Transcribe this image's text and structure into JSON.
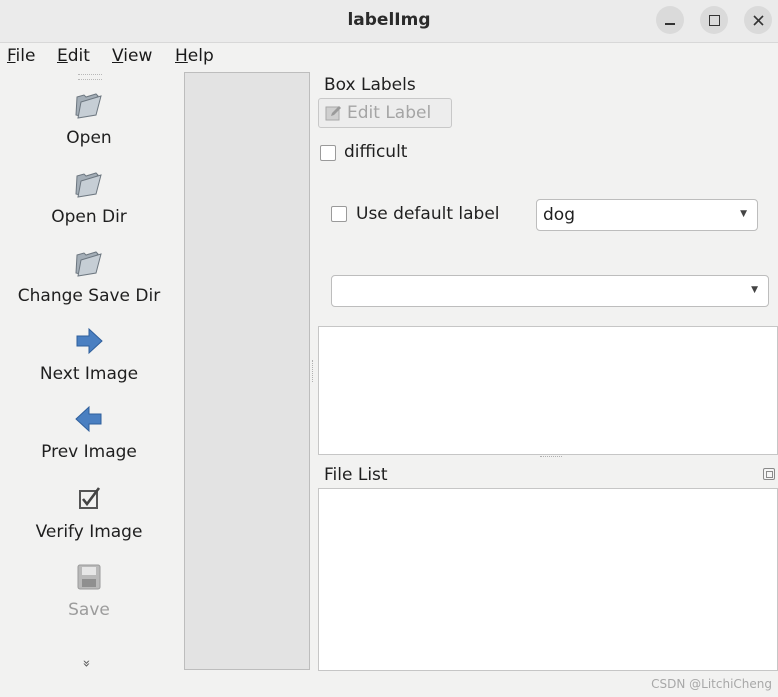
{
  "window": {
    "title": "labelImg",
    "controls": [
      "minimize-icon",
      "maximize-icon",
      "close-icon"
    ]
  },
  "menubar": {
    "items": [
      {
        "label": "File",
        "mnemonic": "F",
        "rest": "ile"
      },
      {
        "label": "Edit",
        "mnemonic": "E",
        "rest": "dit"
      },
      {
        "label": "View",
        "mnemonic": "V",
        "rest": "iew"
      },
      {
        "label": "Help",
        "mnemonic": "H",
        "rest": "elp"
      }
    ]
  },
  "toolbar": {
    "items": [
      {
        "label": "Open",
        "icon": "folder-open-icon",
        "enabled": true
      },
      {
        "label": "Open Dir",
        "icon": "folder-open-icon",
        "enabled": true
      },
      {
        "label": "Change Save Dir",
        "icon": "folder-open-icon",
        "enabled": true
      },
      {
        "label": "Next Image",
        "icon": "arrow-right-icon",
        "enabled": true
      },
      {
        "label": "Prev Image",
        "icon": "arrow-left-icon",
        "enabled": true
      },
      {
        "label": "Verify Image",
        "icon": "checkbox-checked-icon",
        "enabled": true
      },
      {
        "label": "Save",
        "icon": "floppy-disk-icon",
        "enabled": false
      }
    ],
    "more_icon": "chevron-double-down-icon",
    "more_glyph": "»"
  },
  "box_labels": {
    "title": "Box Labels",
    "edit_label_button": "Edit Label",
    "difficult_label": "difficult",
    "difficult_checked": false,
    "use_default_label": "Use default label",
    "use_default_checked": false,
    "default_label_value": "dog",
    "label_filter_value": ""
  },
  "file_list": {
    "title": "File List"
  },
  "watermark": "CSDN @LitchiCheng",
  "colors": {
    "arrow_blue": "#4a7fc1",
    "background": "#f2f2f1"
  }
}
